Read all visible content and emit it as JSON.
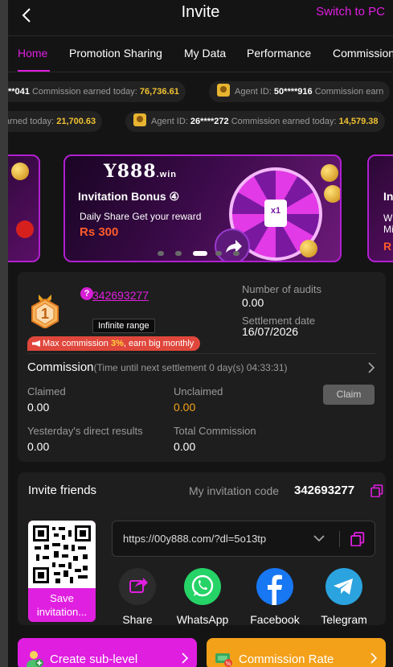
{
  "header": {
    "title": "Invite",
    "switch_label": "Switch to PC"
  },
  "tabs": [
    {
      "label": "Home"
    },
    {
      "label": "Promotion Sharing"
    },
    {
      "label": "My Data"
    },
    {
      "label": "Performance"
    },
    {
      "label": "Commission"
    }
  ],
  "ticker": {
    "row1": [
      {
        "prefix": "**041",
        "label": "Commission earned today:",
        "amount": "76,736.61"
      },
      {
        "label": "Agent ID:",
        "id": "50****916",
        "label2": "Commission earn"
      }
    ],
    "row2": [
      {
        "label": "arned today:",
        "amount": "21,700.63"
      },
      {
        "label": "Agent ID:",
        "id": "26****272",
        "label2": "Commission earned today:",
        "amount": "14,579.38"
      }
    ]
  },
  "banner": {
    "logo_main": "Y888",
    "logo_suffix": ".win",
    "title": "Invitation Bonus ④",
    "subtitle": "Daily Share Get your reward",
    "prize": "Rs 300",
    "wheel_label": "x1",
    "side_title": "In",
    "side_sub1": "W",
    "side_sub2": "Mi",
    "side_prize": "R"
  },
  "commission_card": {
    "medal_rank": "1",
    "agent_code": "342693277",
    "range_badge": "Infinite range",
    "max_prefix": "Max commission ",
    "max_percent": "3%",
    "max_suffix": ", earn big monthly",
    "audits_label": "Number of audits",
    "audits_value": "0.00",
    "settlement_label": "Settlement date",
    "settlement_value": "16/07/2026",
    "commission_title": "Commission",
    "countdown": "(Time until next settlement  0 day(s) 04:33:31)",
    "claimed_label": "Claimed",
    "claimed_value": "0.00",
    "unclaimed_label": "Unclaimed",
    "unclaimed_value": "0.00",
    "claim_button": "Claim",
    "yesterday_label": "Yesterday's direct results",
    "yesterday_value": "0.00",
    "total_label": "Total Commission",
    "total_value": "0.00"
  },
  "invite_card": {
    "title": "Invite friends",
    "code_label": "My invitation code",
    "code_value": "342693277",
    "link": "https://00y888.com/?dl=5o13tp",
    "qr_label": "Save invitation...",
    "share_items": [
      {
        "label": "Share",
        "icon": "share-icon"
      },
      {
        "label": "WhatsApp",
        "icon": "whatsapp-icon"
      },
      {
        "label": "Facebook",
        "icon": "facebook-icon"
      },
      {
        "label": "Telegram",
        "icon": "telegram-icon"
      }
    ]
  },
  "bottom_buttons": {
    "sub_level": "Create sub-level",
    "commission_rate": "Commission Rate"
  },
  "colors": {
    "accent": "#e01ee0",
    "highlight": "#f1c232",
    "orange": "#f3a21b",
    "whatsapp": "#25d366",
    "facebook": "#1877f2",
    "telegram": "#2aa3df"
  }
}
